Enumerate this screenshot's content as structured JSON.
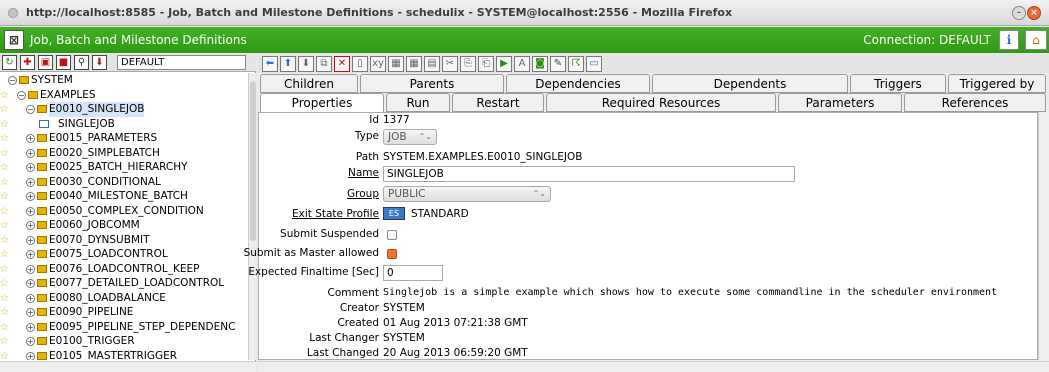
{
  "browser": {
    "title": "http://localhost:8585 - Job, Batch and Milestone Definitions - schedulix - SYSTEM@localhost:2556 - Mozilla Firefox"
  },
  "app": {
    "title": "Job, Batch and Milestone Definitions",
    "connection": "Connection: DEFAULT"
  },
  "left_toolbar": {
    "filter_value": "DEFAULT"
  },
  "tree": [
    {
      "label": "SYSTEM"
    },
    {
      "label": "EXAMPLES"
    },
    {
      "label": "E0010_SINGLEJOB"
    },
    {
      "label": "SINGLEJOB"
    },
    {
      "label": "E0015_PARAMETERS"
    },
    {
      "label": "E0020_SIMPLEBATCH"
    },
    {
      "label": "E0025_BATCH_HIERARCHY"
    },
    {
      "label": "E0030_CONDITIONAL"
    },
    {
      "label": "E0040_MILESTONE_BATCH"
    },
    {
      "label": "E0050_COMPLEX_CONDITION"
    },
    {
      "label": "E0060_JOBCOMM"
    },
    {
      "label": "E0070_DYNSUBMIT"
    },
    {
      "label": "E0075_LOADCONTROL"
    },
    {
      "label": "E0076_LOADCONTROL_KEEP"
    },
    {
      "label": "E0077_DETAILED_LOADCONTROL"
    },
    {
      "label": "E0080_LOADBALANCE"
    },
    {
      "label": "E0090_PIPELINE"
    },
    {
      "label": "E0095_PIPELINE_STEP_DEPENDENC"
    },
    {
      "label": "E0100_TRIGGER"
    },
    {
      "label": "E0105_MASTERTRIGGER"
    }
  ],
  "tabs_row1": [
    "Children",
    "Parents",
    "Dependencies",
    "Dependents",
    "Triggers",
    "Triggered by"
  ],
  "tabs_row2": [
    "Properties",
    "Run",
    "Restart",
    "Required Resources",
    "Parameters",
    "References"
  ],
  "form": {
    "id_label": "Id",
    "id_value": "1377",
    "type_label": "Type",
    "type_value": "JOB",
    "path_label": "Path",
    "path_value": "SYSTEM.EXAMPLES.E0010_SINGLEJOB",
    "name_label": "Name",
    "name_value": "SINGLEJOB",
    "group_label": "Group",
    "group_value": "PUBLIC",
    "exit_state_label": "Exit State Profile",
    "exit_state_value": "STANDARD",
    "submit_suspended_label": "Submit Suspended",
    "submit_master_label": "Submit as Master allowed",
    "expected_finaltime_label": "Expected Finaltime [Sec]",
    "expected_finaltime_value": "0",
    "comment_label": "Comment",
    "comment_value": "Singlejob is a simple example which shows how to execute some commandline in the scheduler environment",
    "creator_label": "Creator",
    "creator_value": "SYSTEM",
    "created_label": "Created",
    "created_value": "01 Aug 2013 07:21:38 GMT",
    "last_changer_label": "Last Changer",
    "last_changer_value": "SYSTEM",
    "last_changed_label": "Last Changed",
    "last_changed_value": "20 Aug 2013 06:59:20 GMT"
  },
  "colors": {
    "appbar": "#3aa81c",
    "folder": "#e6b400",
    "submit_master_checkbox": "#f07030"
  }
}
